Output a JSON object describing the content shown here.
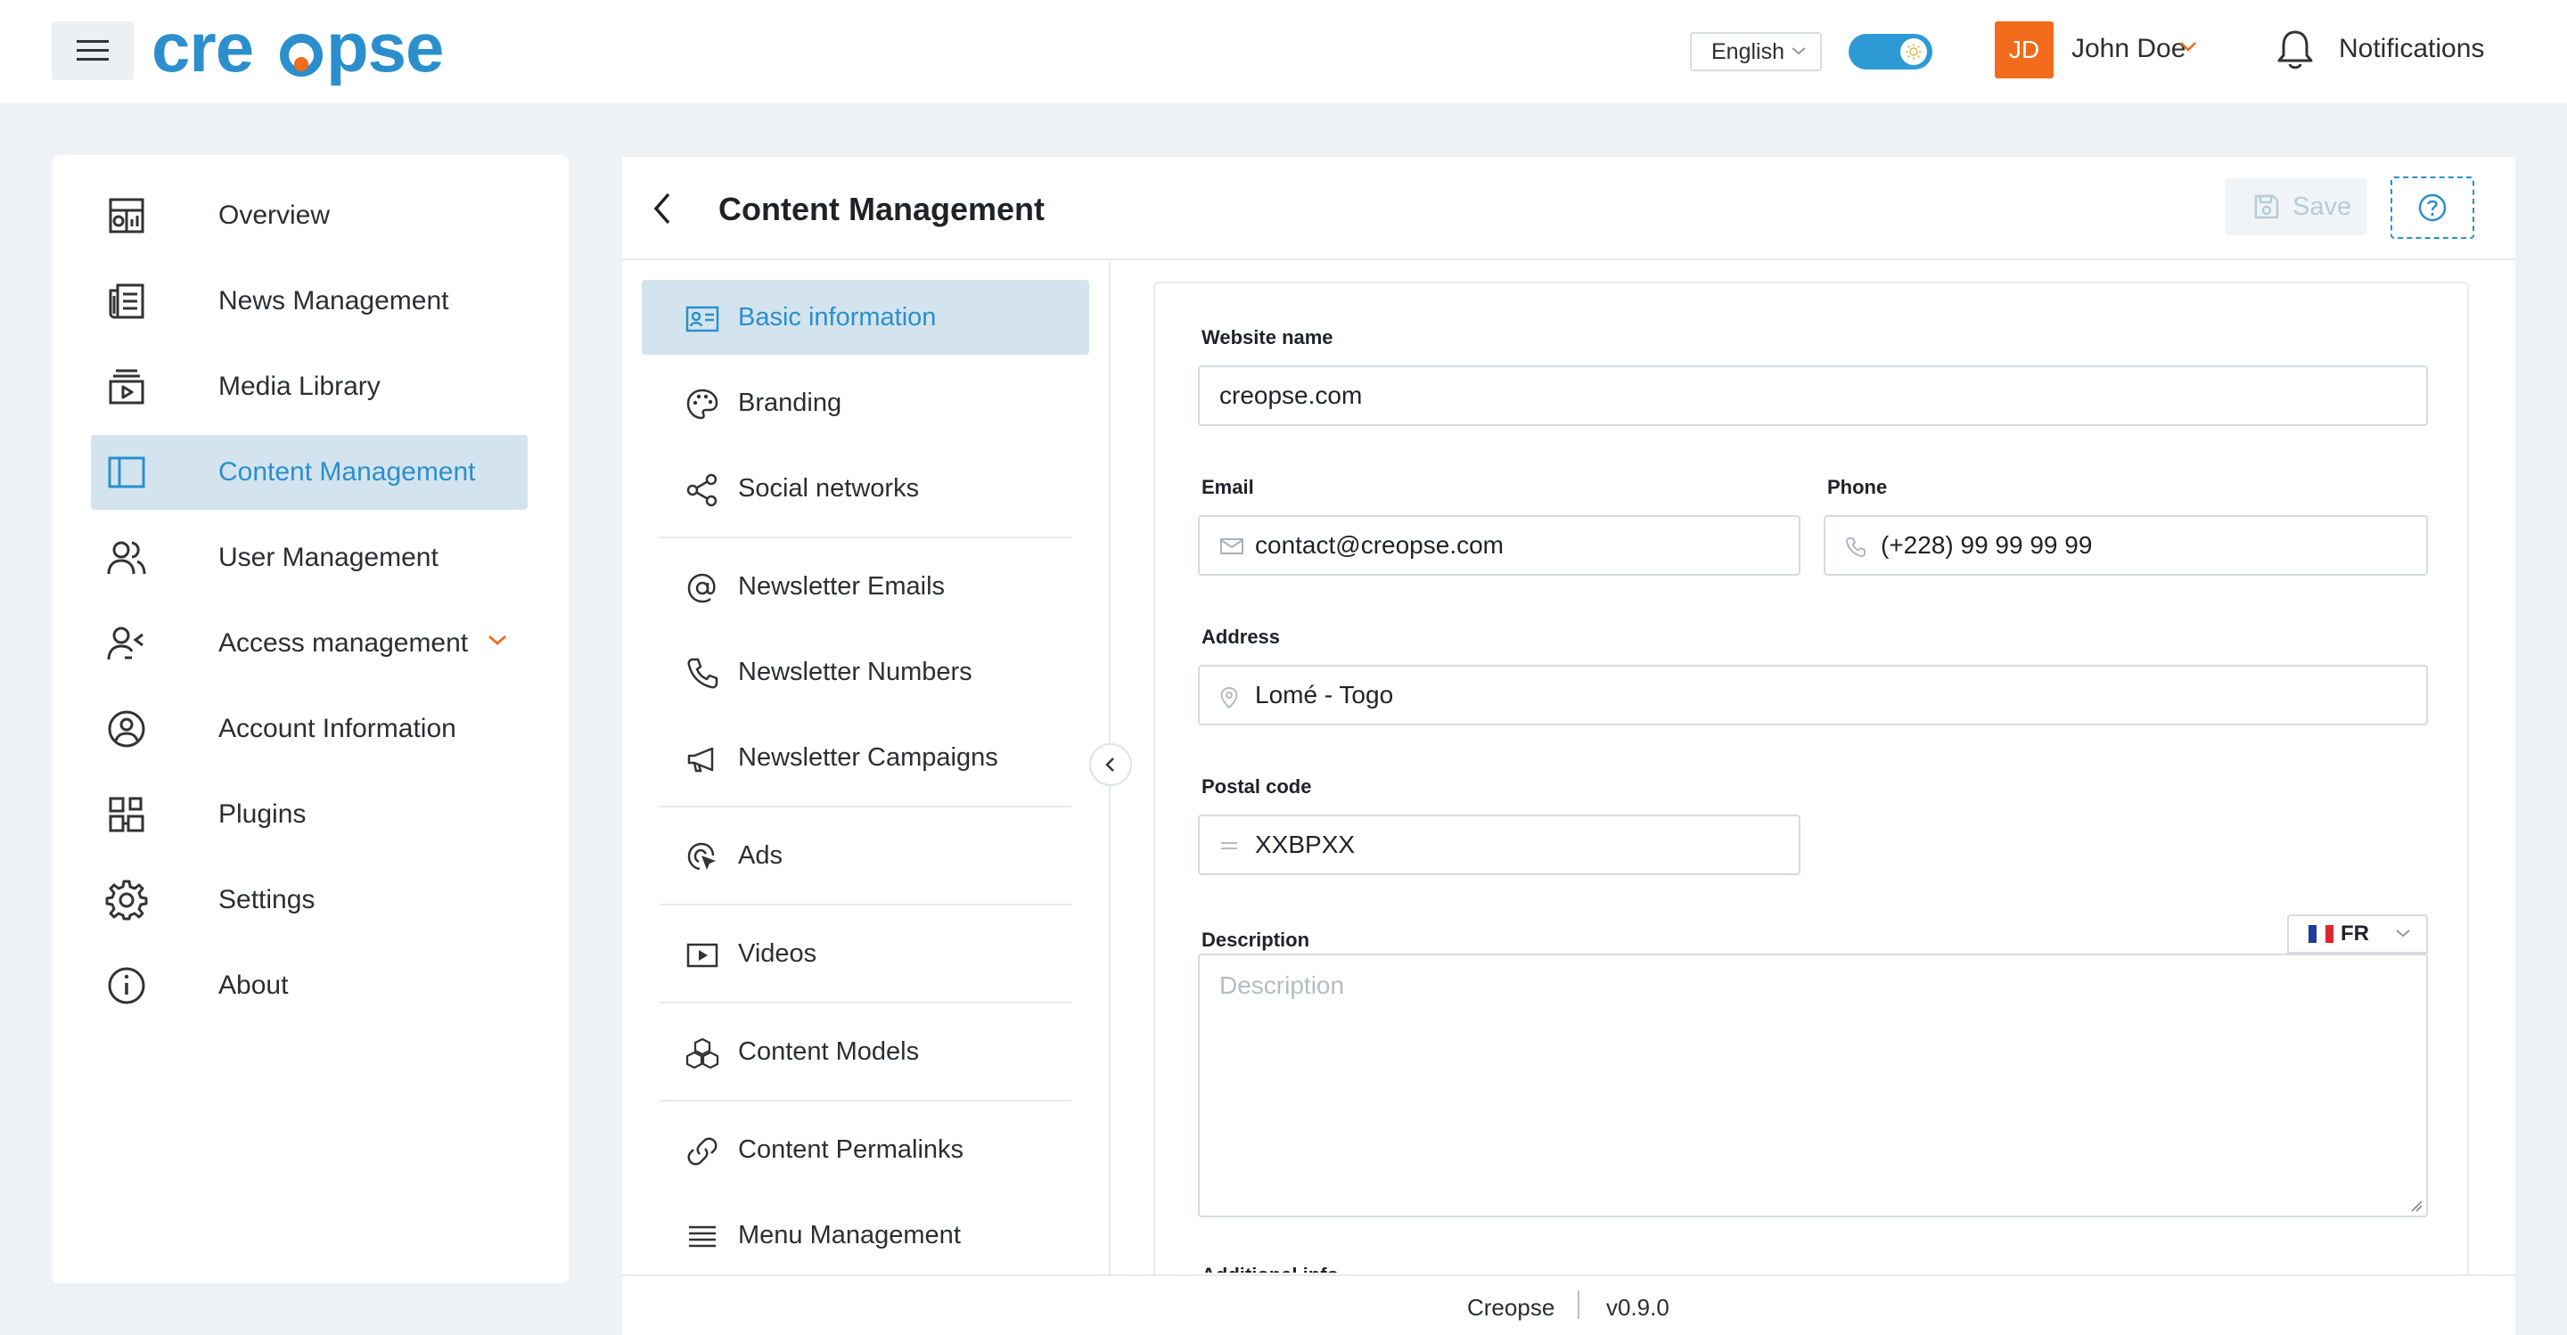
{
  "topbar": {
    "logo_text": "creopse",
    "language": "English",
    "user_initials": "JD",
    "user_name": "John Doe",
    "notifications_label": "Notifications"
  },
  "colors": {
    "brand_blue": "#2b8fcd",
    "brand_orange": "#f26a1b",
    "active_bg": "#d3e4ee",
    "toggle": "#2d9ad6"
  },
  "sidebar": {
    "items": [
      {
        "label": "Overview",
        "icon": "dashboard-icon"
      },
      {
        "label": "News Management",
        "icon": "newspaper-icon"
      },
      {
        "label": "Media Library",
        "icon": "media-library-icon"
      },
      {
        "label": "Content Management",
        "icon": "layout-icon",
        "active": true
      },
      {
        "label": "User Management",
        "icon": "users-icon"
      },
      {
        "label": "Access management",
        "icon": "user-access-icon",
        "has_submenu": true
      },
      {
        "label": "Account Information",
        "icon": "user-circle-icon"
      },
      {
        "label": "Plugins",
        "icon": "plugins-icon"
      },
      {
        "label": "Settings",
        "icon": "gear-icon"
      },
      {
        "label": "About",
        "icon": "info-icon"
      }
    ]
  },
  "main": {
    "title": "Content Management",
    "save_label": "Save",
    "subnav": [
      {
        "label": "Basic information",
        "icon": "id-card-icon",
        "active": true
      },
      {
        "label": "Branding",
        "icon": "palette-icon"
      },
      {
        "label": "Social networks",
        "icon": "share-icon"
      },
      {
        "label": "Newsletter Emails",
        "icon": "at-icon"
      },
      {
        "label": "Newsletter Numbers",
        "icon": "phone-icon"
      },
      {
        "label": "Newsletter Campaigns",
        "icon": "megaphone-icon"
      },
      {
        "label": "Ads",
        "icon": "ad-click-icon"
      },
      {
        "label": "Videos",
        "icon": "video-icon"
      },
      {
        "label": "Content Models",
        "icon": "cubes-icon"
      },
      {
        "label": "Content Permalinks",
        "icon": "link-icon"
      },
      {
        "label": "Menu Management",
        "icon": "menu-icon"
      }
    ],
    "form": {
      "website_name": {
        "label": "Website name",
        "value": "creopse.com"
      },
      "email": {
        "label": "Email",
        "value": "contact@creopse.com"
      },
      "phone": {
        "label": "Phone",
        "value": "(+228) 99 99 99 99"
      },
      "address": {
        "label": "Address",
        "value": "Lomé - Togo"
      },
      "postal_code": {
        "label": "Postal code",
        "value": "XXBPXX"
      },
      "description": {
        "label": "Description",
        "placeholder": "Description",
        "language": "FR"
      },
      "next_label": "Additional info"
    }
  },
  "footer": {
    "app_name": "Creopse",
    "version": "v0.9.0"
  }
}
